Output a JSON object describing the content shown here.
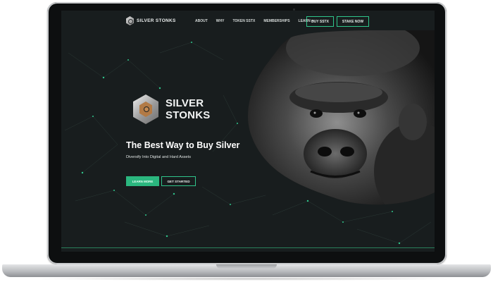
{
  "nav": {
    "logo_text": "SILVER STONKS",
    "links": [
      {
        "label": "ABOUT"
      },
      {
        "label": "WHY"
      },
      {
        "label": "TOKEN SSTX"
      },
      {
        "label": "MEMBERSHIPS"
      },
      {
        "label": "LEARN",
        "has_dropdown": true
      }
    ],
    "buy_button": "BUY SSTX",
    "stake_button": "STAKE NOW"
  },
  "hero": {
    "brand_line1": "SILVER",
    "brand_line2": "STONKS",
    "headline": "The Best Way to Buy Silver",
    "subheadline": "Diversify Into Digital and Hard Assets",
    "primary_button": "LEARN MORE",
    "secondary_button": "GET STARTED",
    "image_subject": "gorilla portrait"
  },
  "icons": {
    "logo": "hexagon-circuit-logo-icon",
    "caret": "chevron-down-icon"
  },
  "colors": {
    "accent": "#2bb77f",
    "background": "#181d1e",
    "text": "#ffffff"
  }
}
